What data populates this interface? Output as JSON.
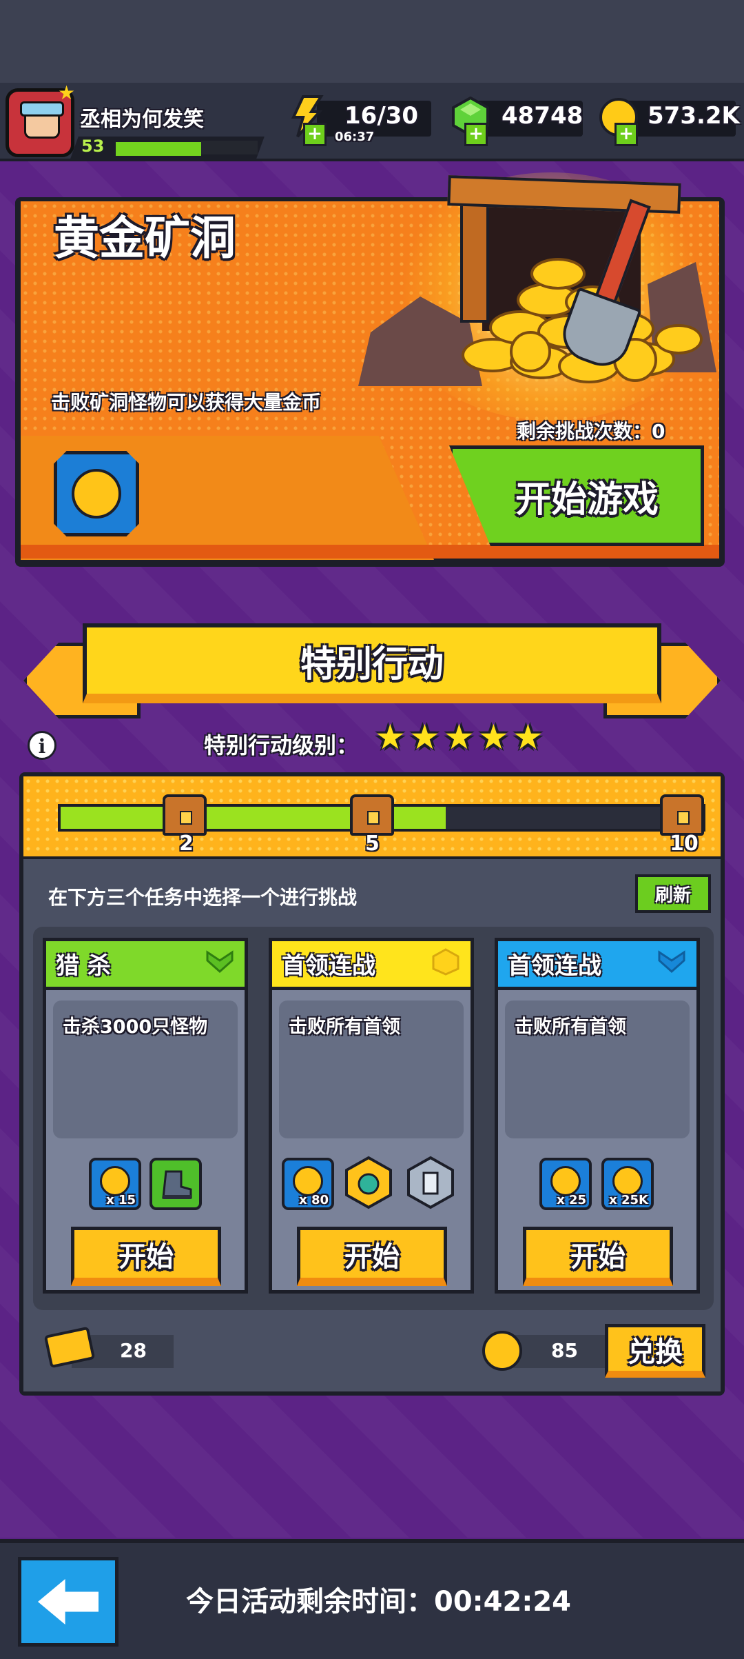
{
  "player": {
    "name": "丞相为何发笑",
    "level": "53",
    "xp_progress": 0.6
  },
  "resources": {
    "energy": "16/30",
    "energy_timer": "06:37",
    "gems": "48748",
    "coins": "573.2K"
  },
  "gold_mine": {
    "title": "黄金矿洞",
    "description": "击败矿洞怪物可以获得大量金币",
    "remaining_label": "剩余挑战次数：0",
    "start_button": "开始游戏"
  },
  "special": {
    "banner_title": "特别行动",
    "level_label": "特别行动级别：",
    "stars": 5,
    "progress": 0.6,
    "milestones": [
      "2",
      "5",
      "10"
    ],
    "instruction": "在下方三个任务中选择一个进行挑战",
    "refresh_label": "刷新",
    "tasks": [
      {
        "title": "猎 杀",
        "description": "击杀3000只怪物",
        "header_color": "#7fd92a",
        "rewards": [
          "x 15",
          ""
        ],
        "start_label": "开始"
      },
      {
        "title": "首领连战",
        "description": "击败所有首领",
        "header_color": "#ffe41c",
        "rewards": [
          "x 80",
          "",
          ""
        ],
        "start_label": "开始"
      },
      {
        "title": "首领连战",
        "description": "击败所有首领",
        "header_color": "#1fa6ee",
        "rewards": [
          "x 25",
          "x 25K"
        ],
        "start_label": "开始"
      }
    ],
    "ticket_count": "28",
    "token_count": "85",
    "exchange_label": "兑换"
  },
  "footer": {
    "timer_label": "今日活动剩余时间：00:42:24"
  }
}
